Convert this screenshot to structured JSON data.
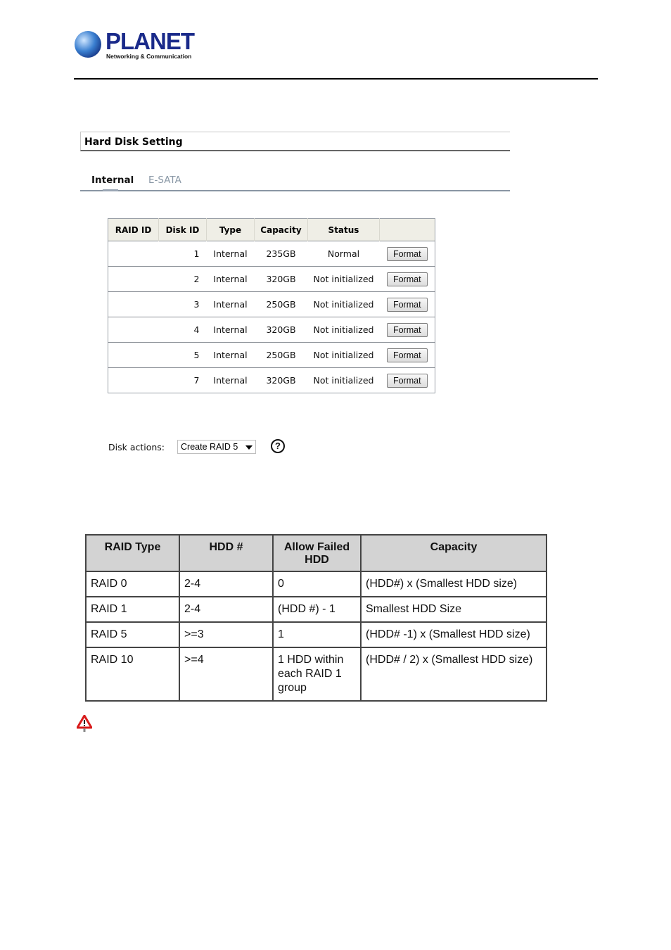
{
  "header": {
    "logo_text": "PLANET",
    "logo_subtext": "Networking & Communication"
  },
  "panel": {
    "title": "Hard Disk Setting",
    "tabs": [
      {
        "label": "Internal",
        "active": true
      },
      {
        "label": "E-SATA",
        "active": false
      }
    ]
  },
  "disk_table": {
    "columns": [
      "RAID ID",
      "Disk ID",
      "Type",
      "Capacity",
      "Status",
      ""
    ],
    "rows": [
      {
        "raid_id": "",
        "disk_id": "1",
        "type": "Internal",
        "capacity": "235GB",
        "status": "Normal",
        "action": "Format"
      },
      {
        "raid_id": "",
        "disk_id": "2",
        "type": "Internal",
        "capacity": "320GB",
        "status": "Not initialized",
        "action": "Format"
      },
      {
        "raid_id": "",
        "disk_id": "3",
        "type": "Internal",
        "capacity": "250GB",
        "status": "Not initialized",
        "action": "Format"
      },
      {
        "raid_id": "",
        "disk_id": "4",
        "type": "Internal",
        "capacity": "320GB",
        "status": "Not initialized",
        "action": "Format"
      },
      {
        "raid_id": "",
        "disk_id": "5",
        "type": "Internal",
        "capacity": "250GB",
        "status": "Not initialized",
        "action": "Format"
      },
      {
        "raid_id": "",
        "disk_id": "7",
        "type": "Internal",
        "capacity": "320GB",
        "status": "Not initialized",
        "action": "Format"
      }
    ]
  },
  "disk_actions": {
    "label": "Disk actions:",
    "selected": "Create RAID 5",
    "help_icon": "question-circle-icon"
  },
  "raid_table": {
    "columns": [
      "RAID Type",
      "HDD #",
      "Allow Failed HDD",
      "Capacity"
    ],
    "rows": [
      [
        "RAID 0",
        "2-4",
        "0",
        "(HDD#) x (Smallest HDD size)"
      ],
      [
        "RAID 1",
        "2-4",
        "(HDD #) - 1",
        "Smallest HDD Size"
      ],
      [
        "RAID 5",
        ">=3",
        "1",
        "(HDD# -1) x (Smallest HDD size)"
      ],
      [
        "RAID 10",
        ">=4",
        "1 HDD within each RAID 1 group",
        "(HDD# / 2) x (Smallest HDD size)"
      ]
    ]
  },
  "note": {
    "icon": "warning-icon"
  }
}
